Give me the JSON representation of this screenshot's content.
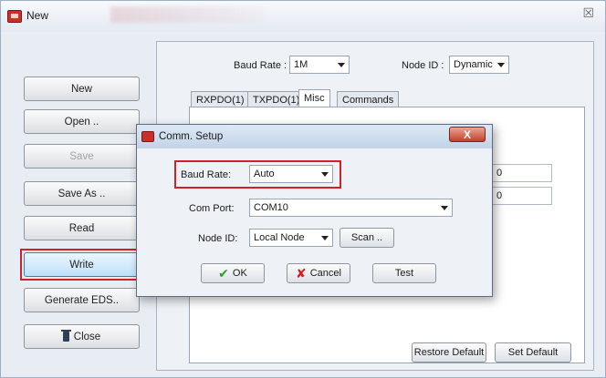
{
  "window": {
    "title": "New",
    "close_glyph": "☒"
  },
  "sidebar": {
    "new": "New",
    "open": "Open ..",
    "save": "Save",
    "save_as": "Save As ..",
    "read": "Read",
    "write": "Write",
    "generate": "Generate EDS..",
    "close": "Close",
    "close_icon": "trash-icon"
  },
  "top": {
    "baud_label": "Baud Rate :",
    "baud_value": "1M",
    "node_label": "Node ID :",
    "node_value": "Dynamic"
  },
  "tabs": [
    "RXPDO(1)",
    "TXPDO(1)",
    "Misc",
    "Commands"
  ],
  "misc": {
    "field1": "0",
    "field2": "0",
    "restore_default": "Restore Default",
    "set_default": "Set Default"
  },
  "dialog": {
    "title": "Comm. Setup",
    "close_glyph": "X",
    "baud_label": "Baud Rate:",
    "baud_value": "Auto",
    "com_label": "Com Port:",
    "com_value": "COM10",
    "node_label": "Node ID:",
    "node_value": "Local Node",
    "scan": "Scan ..",
    "ok": "OK",
    "cancel": "Cancel",
    "test": "Test"
  },
  "colors": {
    "highlight_frame": "#d21f2b",
    "write_button": "#bfe0f8",
    "ok_check": "#2e9a2e",
    "cancel_x": "#d31f1f"
  }
}
